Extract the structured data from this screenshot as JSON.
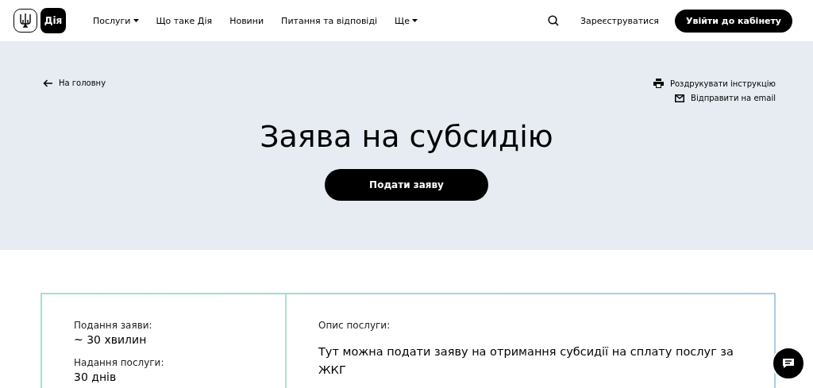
{
  "header": {
    "logo_text": "Дія",
    "nav": [
      {
        "label": "Послуги",
        "kind": "dropdown"
      },
      {
        "label": "Що таке Дія",
        "kind": "link"
      },
      {
        "label": "Новини",
        "kind": "link"
      },
      {
        "label": "Питання та відповіді",
        "kind": "link"
      },
      {
        "label": "Ще",
        "kind": "dropdown"
      }
    ],
    "register": "Зареєструватися",
    "login": "Увійти до кабінету"
  },
  "hero": {
    "back": "На головну",
    "actions": [
      {
        "label": "Роздрукувати інструкцію",
        "kind": "print"
      },
      {
        "label": "Відправити на email",
        "kind": "email"
      }
    ],
    "title": "Заява на субсидію",
    "cta": "Подати заяву"
  },
  "details": {
    "facts": [
      {
        "label": "Подання заяви:",
        "value": "~ 30 хвилин"
      },
      {
        "label": "Надання послуги:",
        "value": "30 днів"
      }
    ],
    "description_label": "Опис послуги:",
    "description": "Тут можна подати заяву на отримання субсидії на сплату послуг за ЖКГ"
  }
}
